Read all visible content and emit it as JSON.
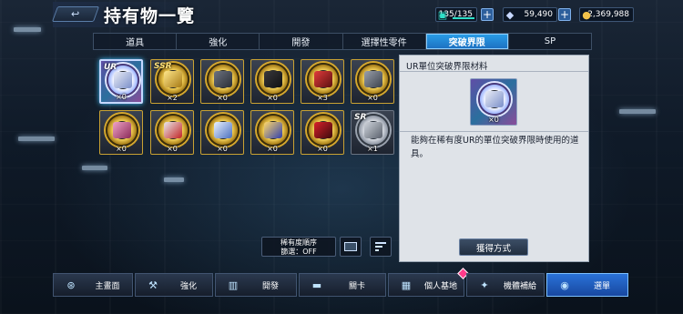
{
  "header": {
    "back_icon": "return-arrow-icon",
    "back_glyph": "↩",
    "title": "持有物一覽"
  },
  "resources": {
    "stamina": {
      "value": "135/135",
      "icon": "stamina-icon"
    },
    "gems": {
      "value": "59,490",
      "icon": "gem-icon"
    },
    "coins": {
      "value": "2,369,988",
      "icon": "coin-icon"
    }
  },
  "tabs": [
    {
      "label": "道具"
    },
    {
      "label": "強化"
    },
    {
      "label": "開發"
    },
    {
      "label": "選擇性零件"
    },
    {
      "label": "突破界限"
    },
    {
      "label": "SP"
    }
  ],
  "items": [
    {
      "rank": "UR",
      "count": "×0"
    },
    {
      "rank": "SSR",
      "count": "×2"
    },
    {
      "rank": "",
      "count": "×0"
    },
    {
      "rank": "",
      "count": "×0"
    },
    {
      "rank": "",
      "count": "×3"
    },
    {
      "rank": "",
      "count": "×0"
    },
    {
      "rank": "",
      "count": "×0"
    },
    {
      "rank": "",
      "count": "×0"
    },
    {
      "rank": "",
      "count": "×0"
    },
    {
      "rank": "",
      "count": "×0"
    },
    {
      "rank": "",
      "count": "×0"
    },
    {
      "rank": "SR",
      "count": "×1"
    }
  ],
  "sort": {
    "order_label": "稀有度順序",
    "filter_label": "篩選：OFF"
  },
  "detail": {
    "title": "UR單位突破界限材料",
    "count": "×0",
    "description": "能夠在稀有度UR的單位突破界限時使用的道具。",
    "obtain_button": "獲得方式"
  },
  "bottom_nav": [
    {
      "label": "主畫面",
      "icon": "home-icon"
    },
    {
      "label": "強化",
      "icon": "wrench-icon"
    },
    {
      "label": "開發",
      "icon": "factory-icon"
    },
    {
      "label": "關卡",
      "icon": "weapon-icon"
    },
    {
      "label": "個人基地",
      "icon": "base-icon"
    },
    {
      "label": "機體補給",
      "icon": "supply-icon"
    },
    {
      "label": "選單",
      "icon": "menu-icon"
    }
  ]
}
